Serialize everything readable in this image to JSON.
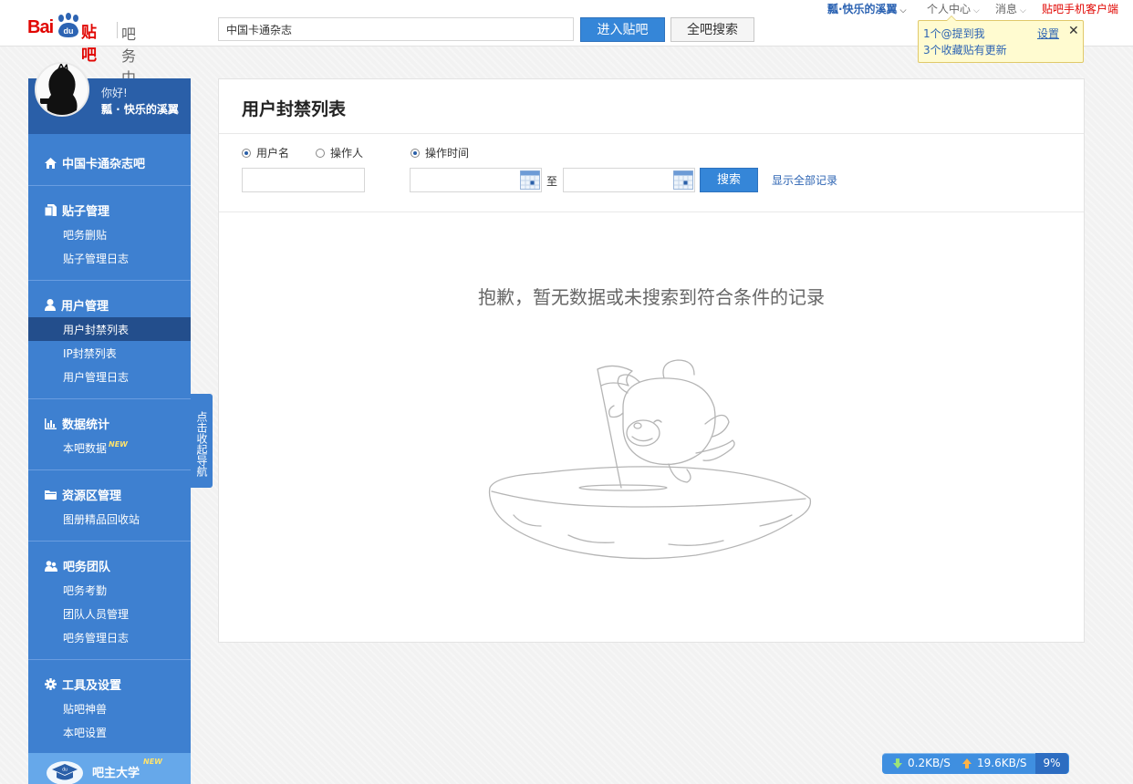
{
  "header": {
    "logo": {
      "bai": "Bai",
      "du": "du",
      "tieba": "贴吧",
      "center": "吧务中心"
    },
    "search": {
      "value": "中国卡通杂志"
    },
    "enter_button": "进入贴吧",
    "all_search_button": "全吧搜索",
    "user_name": "瓢·快乐的溪翼",
    "personal_center": "个人中心",
    "messages": "消息",
    "mobile_client": "贴吧手机客户端"
  },
  "notification": {
    "line1": "1个@提到我",
    "line2": "3个收藏贴有更新",
    "settings": "设置",
    "close": "✕"
  },
  "sidebar": {
    "greeting": "你好!",
    "user_name": "瓢 · 快乐的溪翼",
    "forum": "中国卡通杂志吧",
    "sections": [
      {
        "title": "贴子管理",
        "items": [
          "吧务删贴",
          "贴子管理日志"
        ]
      },
      {
        "title": "用户管理",
        "items": [
          "用户封禁列表",
          "IP封禁列表",
          "用户管理日志"
        ]
      },
      {
        "title": "数据统计",
        "items": [
          "本吧数据"
        ]
      },
      {
        "title": "资源区管理",
        "items": [
          "图册精品回收站"
        ]
      },
      {
        "title": "吧务团队",
        "items": [
          "吧务考勤",
          "团队人员管理",
          "吧务管理日志"
        ]
      },
      {
        "title": "工具及设置",
        "items": [
          "贴吧神兽",
          "本吧设置"
        ]
      }
    ],
    "new_tag": "NEW",
    "university": "吧主大学",
    "collapse_tab": "点击收起导航"
  },
  "main": {
    "title": "用户封禁列表",
    "radio_username": "用户名",
    "radio_operator": "操作人",
    "radio_time": "操作时间",
    "to_label": "至",
    "search_button": "搜索",
    "show_all": "显示全部记录",
    "empty_message": "抱歉，暂无数据或未搜索到符合条件的记录"
  },
  "netspeed": {
    "download": "0.2KB/S",
    "upload": "19.6KB/S",
    "percent": "9%"
  },
  "colors": {
    "brand_red": "#e10602",
    "primary_blue": "#3586d8",
    "sidebar_blue": "#3e80d0",
    "sidebar_dark": "#2a5fa8",
    "link_blue": "#2d64b3"
  }
}
